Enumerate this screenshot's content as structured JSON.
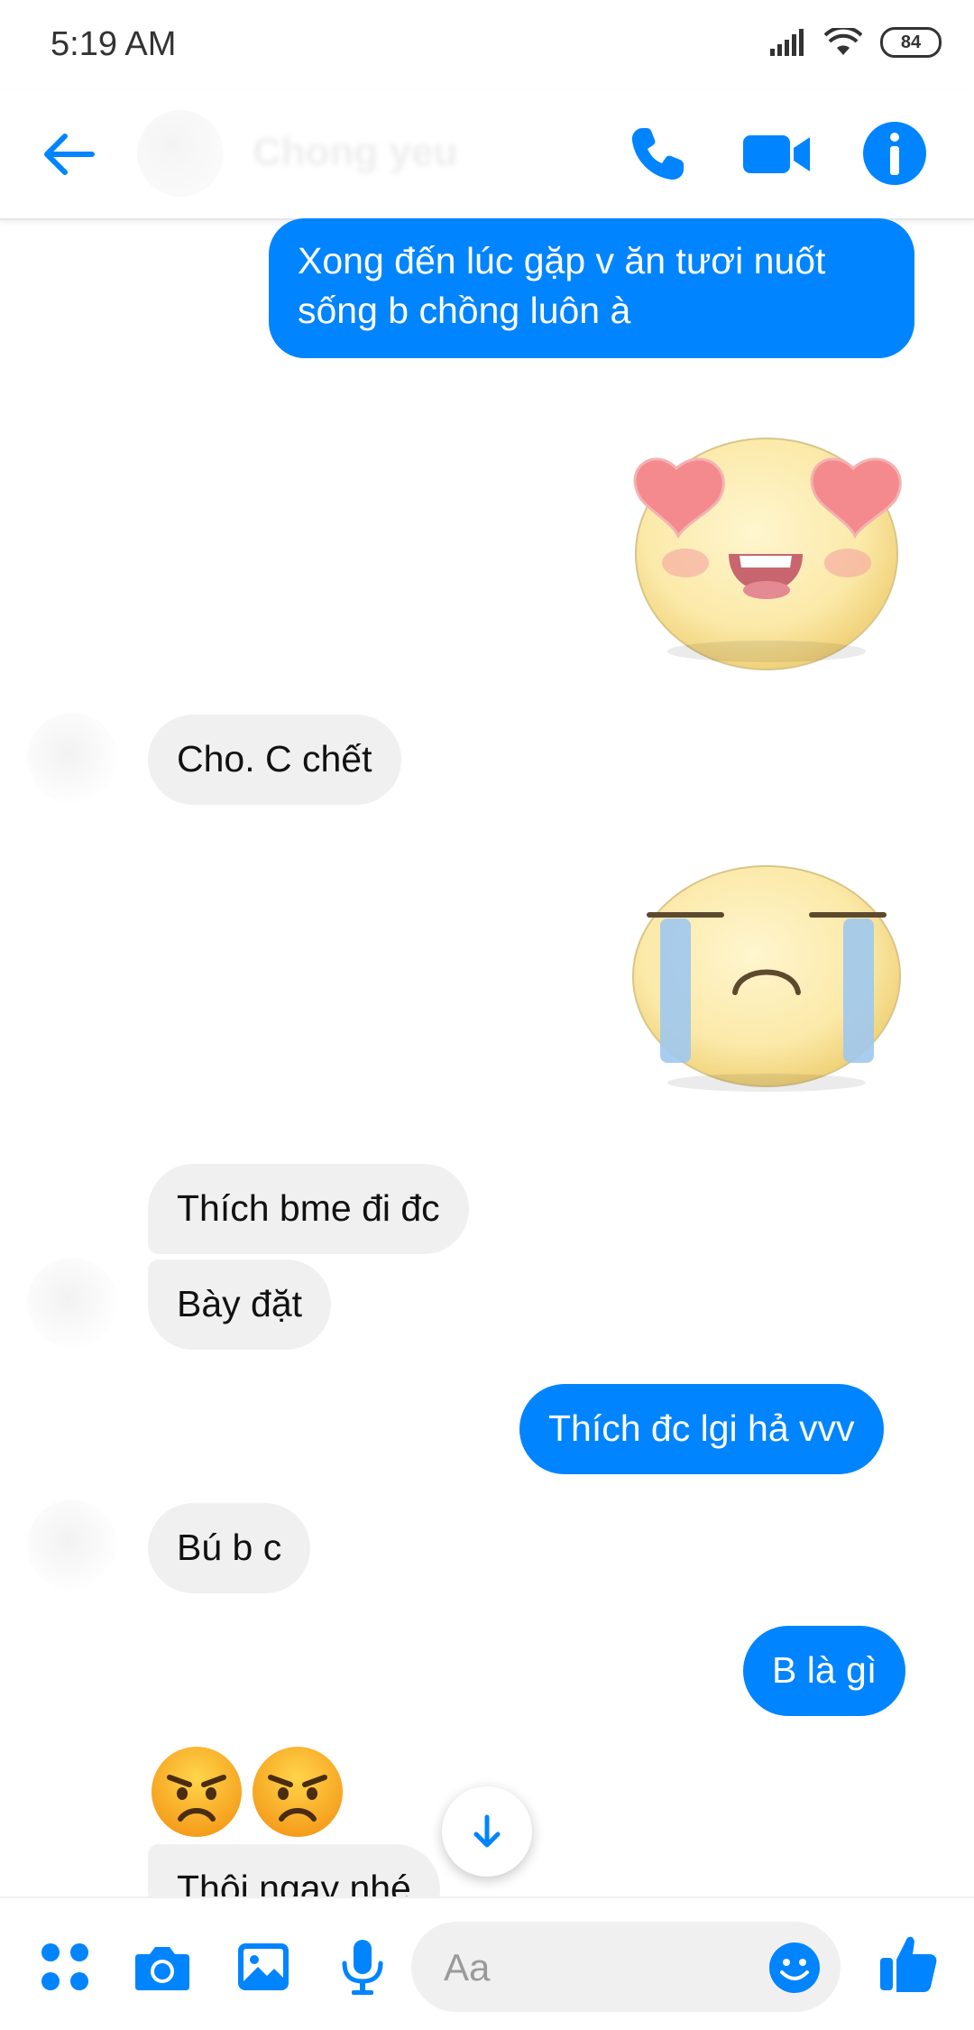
{
  "status_bar": {
    "time": "5:19  AM",
    "battery": "84"
  },
  "header": {
    "contact_name": "Chong yeu",
    "icons": [
      "back-arrow-icon",
      "phone-icon",
      "video-camera-icon",
      "info-icon"
    ]
  },
  "messages": [
    {
      "side": "out",
      "text_line1": "Xong đến lúc gặp v ăn tươi nuốt",
      "text_line2": "sống b chồng luôn à"
    },
    {
      "side": "out",
      "sticker": "heart-eyes-sticker"
    },
    {
      "side": "in",
      "text": "Cho. C chết"
    },
    {
      "side": "out",
      "sticker": "crying-sticker"
    },
    {
      "side": "in",
      "text": "Thích bme đi đc"
    },
    {
      "side": "in",
      "text": "Bày đặt"
    },
    {
      "side": "out",
      "text": "Thích đc lgi hả vvv"
    },
    {
      "side": "in",
      "text": "Bú b c"
    },
    {
      "side": "out",
      "text": "B là gì"
    },
    {
      "side": "in",
      "emoji": [
        "angry-face",
        "angry-face"
      ]
    },
    {
      "side": "in",
      "text": "Thôi ngay nhé"
    }
  ],
  "composer": {
    "placeholder": "Aa",
    "icons": [
      "menu-dots-icon",
      "camera-icon",
      "gallery-icon",
      "microphone-icon",
      "emoji-icon",
      "thumbs-up-icon"
    ]
  },
  "colors": {
    "accent": "#0084ff",
    "incoming_bubble": "#f1f0f0"
  }
}
